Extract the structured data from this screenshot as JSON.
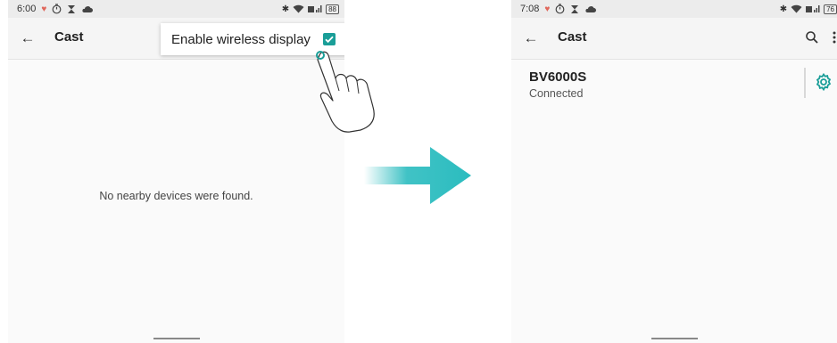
{
  "left": {
    "status": {
      "time": "6:00",
      "battery": "88"
    },
    "app_bar": {
      "back_icon": "←",
      "title": "Cast"
    },
    "menu": {
      "label": "Enable wireless display",
      "checked": true
    },
    "empty_message": "No nearby devices were found."
  },
  "right": {
    "status": {
      "time": "7:08",
      "battery": "76"
    },
    "app_bar": {
      "back_icon": "←",
      "title": "Cast",
      "search_icon": "⚲",
      "more_icon": "⋮"
    },
    "devices": [
      {
        "name": "BV6000S",
        "status": "Connected"
      }
    ]
  },
  "colors": {
    "accent": "#1a9e98",
    "arrow": "#2bbcbf",
    "status_bar": "#ececec",
    "app_bar": "#f5f5f5"
  },
  "icons": [
    "heart-icon",
    "timer-icon",
    "hourglass-icon",
    "cloud-icon",
    "bluetooth-icon",
    "wifi-icon",
    "signal-icon",
    "battery-icon",
    "back-arrow-icon",
    "search-icon",
    "more-vert-icon",
    "gear-icon",
    "checkbox-icon",
    "pointing-hand-icon",
    "right-arrow-icon"
  ]
}
